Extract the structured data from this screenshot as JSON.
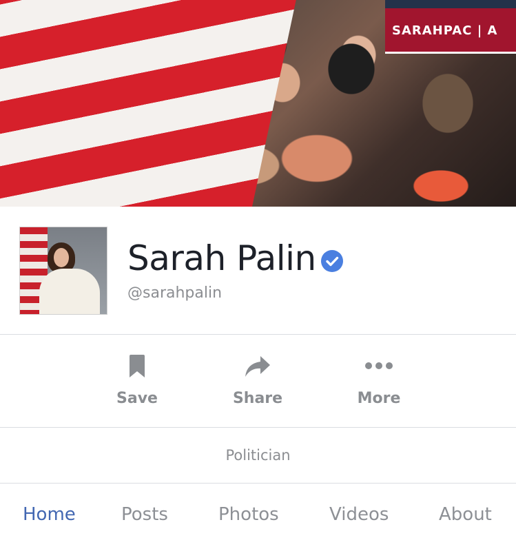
{
  "cover": {
    "banner_text": "SARAHPAC | A",
    "description": "cover photo"
  },
  "profile": {
    "name": "Sarah Palin",
    "username": "@sarahpalin",
    "verified_icon": "verified-badge-icon",
    "verified_color": "#4a7fe0"
  },
  "actions": [
    {
      "label": "Save",
      "icon": "bookmark-icon"
    },
    {
      "label": "Share",
      "icon": "share-arrow-icon"
    },
    {
      "label": "More",
      "icon": "more-dots-icon"
    }
  ],
  "category": "Politician",
  "tabs": [
    {
      "label": "Home",
      "active": true
    },
    {
      "label": "Posts",
      "active": false
    },
    {
      "label": "Photos",
      "active": false
    },
    {
      "label": "Videos",
      "active": false
    },
    {
      "label": "About",
      "active": false
    }
  ],
  "colors": {
    "accent": "#4267b2",
    "muted_text": "#8a8d91",
    "divider": "#dadde1"
  }
}
